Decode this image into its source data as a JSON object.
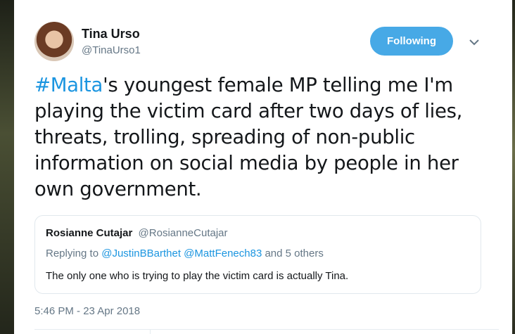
{
  "tweet": {
    "author_name": "Tina Urso",
    "author_handle": "@TinaUrso1",
    "follow_label": "Following",
    "text_hashtag": "#Malta",
    "text_rest": "'s youngest female MP telling me I'm playing the victim card after two days of lies, threats, trolling, spreading of non-public information on social media by people in her own government.",
    "timestamp": "5:46 PM - 23 Apr 2018"
  },
  "quote": {
    "author_name": "Rosianne Cutajar",
    "author_handle": "@RosianneCutajar",
    "replying_prefix": "Replying to",
    "replying_users": "@JustinBBarthet @MattFenech83",
    "replying_suffix": "and 5 others",
    "text": "The only one who is trying to play the victim card is actually Tina."
  },
  "colors": {
    "accent": "#1b95e0",
    "follow_button": "#47a9e6",
    "secondary_text": "#657786",
    "primary_text": "#14171a"
  },
  "icons": {
    "menu": "chevron-down-icon"
  }
}
